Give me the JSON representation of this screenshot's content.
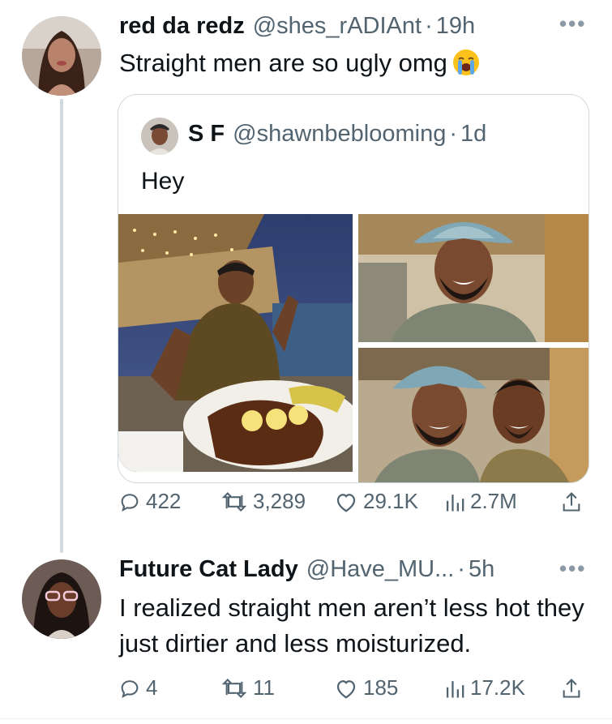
{
  "tweet": {
    "author_name": "red da redz",
    "author_handle": "@shes_rADIAnt",
    "separator": "·",
    "time": "19h",
    "text": "Straight men are so ugly omg",
    "emoji": "loudly-crying-face",
    "more_icon": "more-icon",
    "quote": {
      "author_name": "S F",
      "author_handle": "@shawnbeblooming",
      "separator": "·",
      "time": "1d",
      "text": "Hey",
      "photos": [
        "restaurant-selfie-with-fish-platter",
        "bucket-hat-selfie",
        "two-men-selfie"
      ]
    },
    "actions": {
      "replies": "422",
      "reposts": "3,289",
      "likes": "29.1K",
      "views": "2.7M"
    }
  },
  "reply": {
    "author_name": "Future Cat Lady",
    "author_handle": "@Have_MU...",
    "separator": "·",
    "time": "5h",
    "text": "I realized straight men aren’t less hot they just dirtier and less moisturized.",
    "more_icon": "more-icon",
    "actions": {
      "replies": "4",
      "reposts": "11",
      "likes": "185",
      "views": "17.2K"
    }
  },
  "colors": {
    "text_primary": "#0f1419",
    "text_secondary": "#536471",
    "border": "#cfd9de",
    "thread_line": "#cfd9de"
  }
}
